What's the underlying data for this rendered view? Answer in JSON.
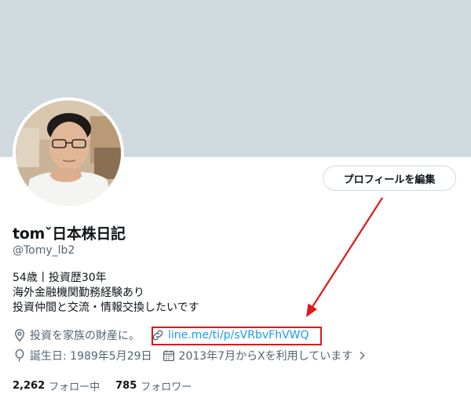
{
  "profile": {
    "display_name": "tomˇ日本株日記",
    "handle": "@Tomy_lb2",
    "bio": [
      "54歳丨投資歴30年",
      "海外金融機関勤務経験あり",
      "投資仲間と交流・情報交換したいです"
    ],
    "location": "投資を家族の財産に。",
    "website": "line.me/ti/p/sVRbvFhVWQ",
    "birthday": "誕生日: 1989年5月29日",
    "joined": "2013年7月からXを利用しています"
  },
  "actions": {
    "edit_profile_label": "プロフィールを編集"
  },
  "stats": {
    "following_count": "2,262",
    "following_label": "フォロー中",
    "followers_count": "785",
    "followers_label": "フォロワー"
  },
  "colors": {
    "banner": "#cfd9de",
    "link": "#1d9bf0",
    "annotation": "#e0161a",
    "secondary_text": "#536471"
  },
  "icons": [
    "location-icon",
    "link-icon",
    "balloon-icon",
    "calendar-icon",
    "chevron-right-icon"
  ]
}
